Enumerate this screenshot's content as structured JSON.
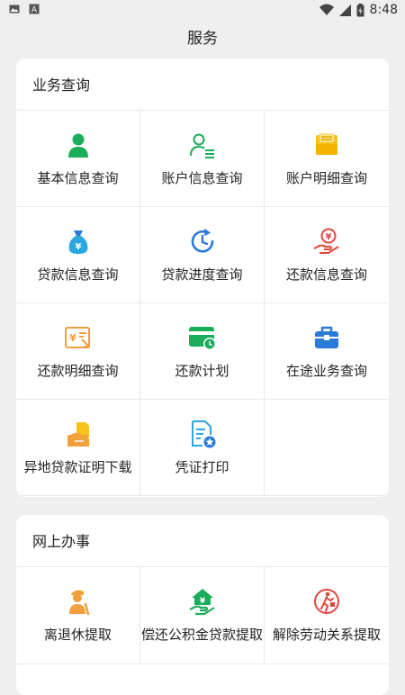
{
  "status_bar": {
    "time": "8:48"
  },
  "header": {
    "title": "服务"
  },
  "sections": [
    {
      "title": "业务查询",
      "items": [
        {
          "label": "基本信息查询",
          "icon": "person-icon"
        },
        {
          "label": "账户信息查询",
          "icon": "account-list-icon"
        },
        {
          "label": "账户明细查询",
          "icon": "folder-details-icon"
        },
        {
          "label": "贷款信息查询",
          "icon": "money-bag-icon"
        },
        {
          "label": "贷款进度查询",
          "icon": "progress-clock-icon"
        },
        {
          "label": "还款信息查询",
          "icon": "repay-hand-icon"
        },
        {
          "label": "还款明细查询",
          "icon": "repay-details-icon"
        },
        {
          "label": "还款计划",
          "icon": "card-clock-icon"
        },
        {
          "label": "在途业务查询",
          "icon": "briefcase-icon"
        },
        {
          "label": "异地贷款证明下载",
          "icon": "document-hand-icon"
        },
        {
          "label": "凭证打印",
          "icon": "certificate-print-icon"
        },
        {
          "label": "",
          "icon": ""
        }
      ]
    },
    {
      "title": "网上办事",
      "items": [
        {
          "label": "离退休提取",
          "icon": "retiree-icon"
        },
        {
          "label": "偿还公积金贷款提取",
          "icon": "house-hand-icon"
        },
        {
          "label": "解除劳动关系提取",
          "icon": "leave-job-icon"
        }
      ]
    }
  ],
  "colors": {
    "green": "#1aad5a",
    "yellow": "#f9c21a",
    "blue": "#2a7bd8",
    "red": "#e2463f",
    "orange": "#f2a03b"
  }
}
